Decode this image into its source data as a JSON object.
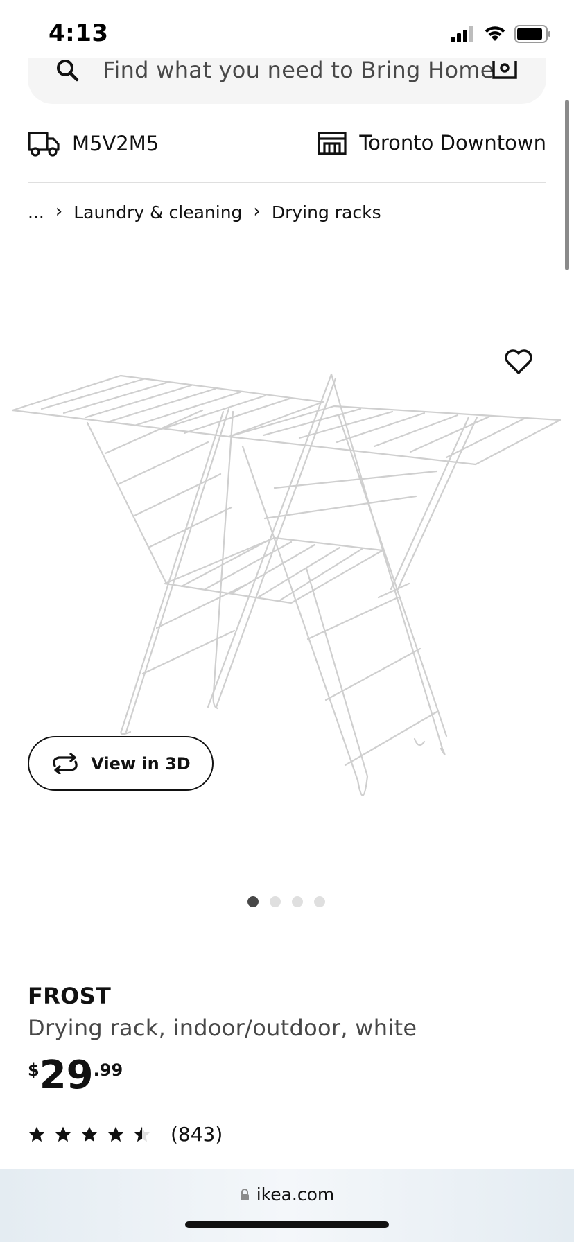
{
  "status_bar": {
    "time": "4:13"
  },
  "search": {
    "placeholder": "Find what you need to Bring Home"
  },
  "location": {
    "postal_code": "M5V2M5",
    "store": "Toronto Downtown"
  },
  "breadcrumb": {
    "ellipsis": "...",
    "items": [
      "Laundry & cleaning",
      "Drying racks"
    ]
  },
  "gallery": {
    "view_3d_label": "View in 3D",
    "dot_count": 4,
    "active_dot": 1
  },
  "product": {
    "name": "FROST",
    "description": "Drying rack, indoor/outdoor, white",
    "price": {
      "currency": "$",
      "integer": "29",
      "decimal": ".99"
    },
    "rating": {
      "value": 4.5,
      "max": 5,
      "count": "(843)"
    }
  },
  "browser": {
    "url": "ikea.com"
  },
  "icons": {
    "search": "search-icon",
    "camera": "camera-search-icon",
    "delivery": "truck-icon",
    "store": "store-icon",
    "favorite": "heart-icon",
    "rotate": "rotate-3d-icon",
    "lock": "lock-icon"
  },
  "colors": {
    "text": "#111111",
    "secondary_text": "#484848",
    "search_bg": "#f5f5f5",
    "divider": "#dfdfdf"
  }
}
